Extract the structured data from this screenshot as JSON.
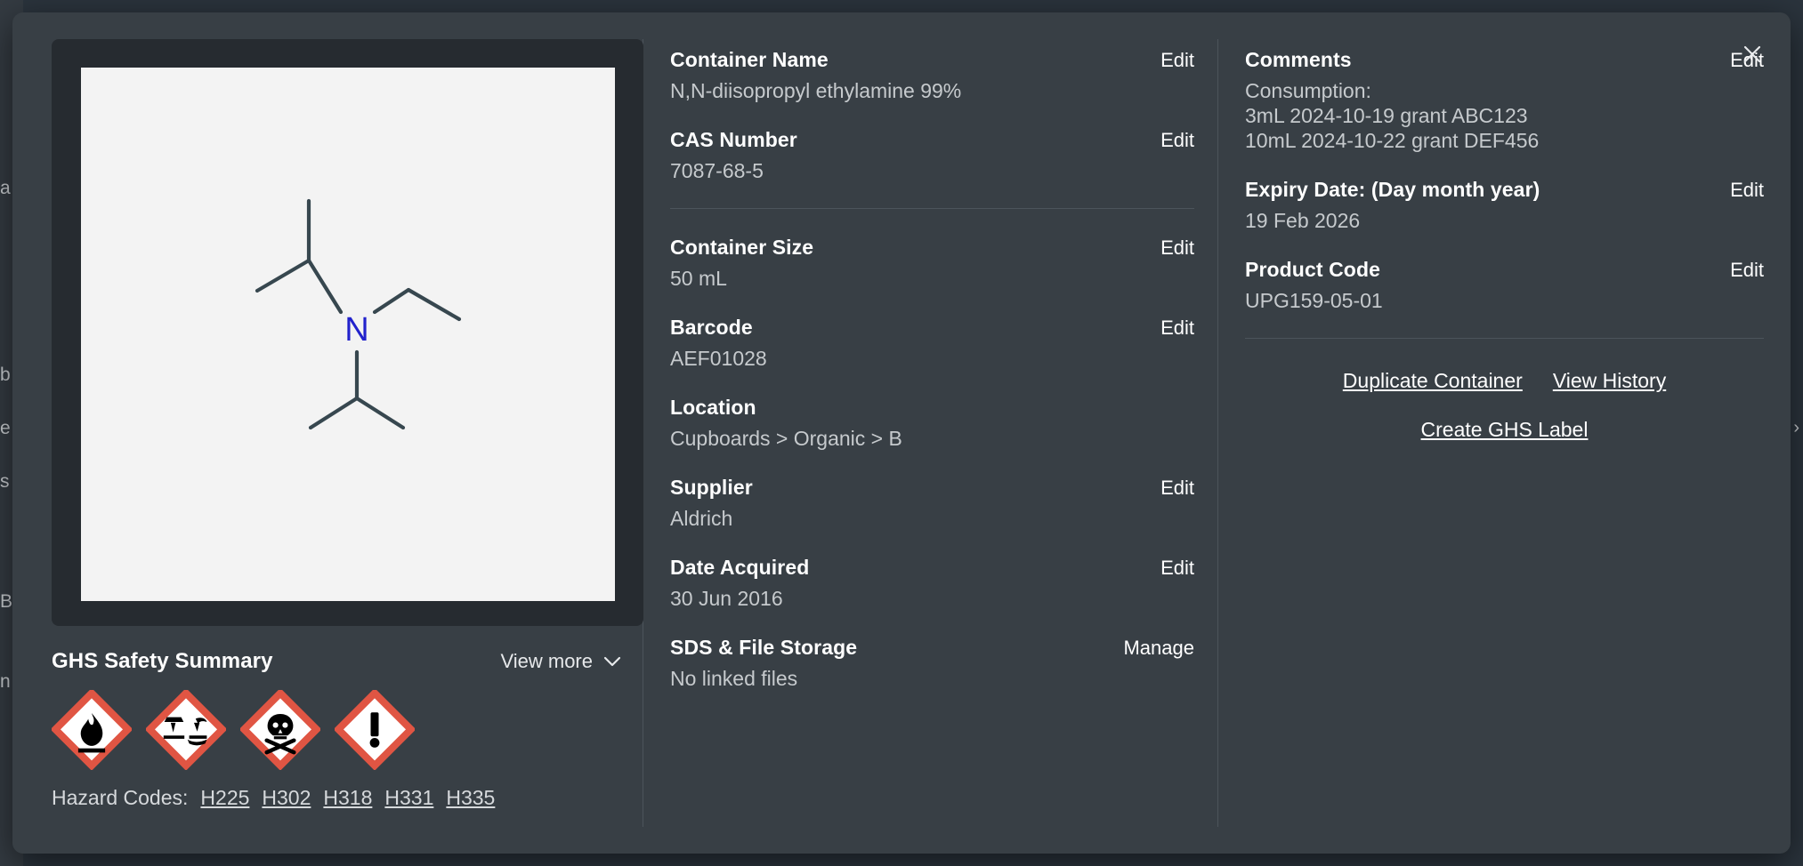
{
  "background": {
    "left_fragments": [
      "a",
      "b",
      "e",
      "s",
      "n",
      "B"
    ],
    "right_chevron": "›"
  },
  "modal": {
    "close_icon": "close-icon",
    "structure": {
      "alt": "N,N-diisopropyl ethylamine skeletal structure",
      "atom_label": "N"
    },
    "ghs": {
      "title": "GHS Safety Summary",
      "view_more_label": "View more",
      "chevron": "⌄",
      "pictograms": [
        {
          "name": "flammable-pictogram",
          "symbol": "flame"
        },
        {
          "name": "corrosive-pictogram",
          "symbol": "corrosion"
        },
        {
          "name": "acute-toxicity-pictogram",
          "symbol": "skull-and-crossbones"
        },
        {
          "name": "harmful-irritant-pictogram",
          "symbol": "exclamation-mark"
        }
      ],
      "hazard_label": "Hazard Codes:",
      "hazard_codes": [
        "H225",
        "H302",
        "H318",
        "H331",
        "H335"
      ]
    },
    "middle_fields": [
      {
        "label": "Container Name",
        "action": "Edit",
        "value": "N,N-diisopropyl ethylamine 99%"
      },
      {
        "label": "CAS Number",
        "action": "Edit",
        "value": "7087-68-5"
      },
      {
        "label": "Container Size",
        "action": "Edit",
        "value": "50 mL"
      },
      {
        "label": "Barcode",
        "action": "Edit",
        "value": "AEF01028"
      },
      {
        "label": "Location",
        "action": "",
        "value": "Cupboards > Organic > B"
      },
      {
        "label": "Supplier",
        "action": "Edit",
        "value": "Aldrich"
      },
      {
        "label": "Date Acquired",
        "action": "Edit",
        "value": "30 Jun 2016"
      },
      {
        "label": "SDS & File Storage",
        "action": "Manage",
        "value": "No linked files"
      }
    ],
    "right_fields": {
      "comments": {
        "label": "Comments",
        "action": "Edit",
        "lines": [
          "Consumption:",
          "3mL 2024-10-19 grant ABC123",
          "10mL 2024-10-22 grant DEF456"
        ]
      },
      "expiry": {
        "label": "Expiry Date: (Day month year)",
        "action": "Edit",
        "value": "19 Feb 2026"
      },
      "product_code": {
        "label": "Product Code",
        "action": "Edit",
        "value": "UPG159-05-01"
      }
    },
    "actions": {
      "duplicate": "Duplicate Container",
      "history": "View History",
      "ghs_label": "Create GHS Label"
    }
  },
  "colors": {
    "modal_bg": "#383f45",
    "page_bg": "#2b343d",
    "card_bg": "#262b30",
    "accent_red": "#e05543",
    "nitrogen_blue": "#2222cc",
    "bond_gray": "#37474f"
  }
}
